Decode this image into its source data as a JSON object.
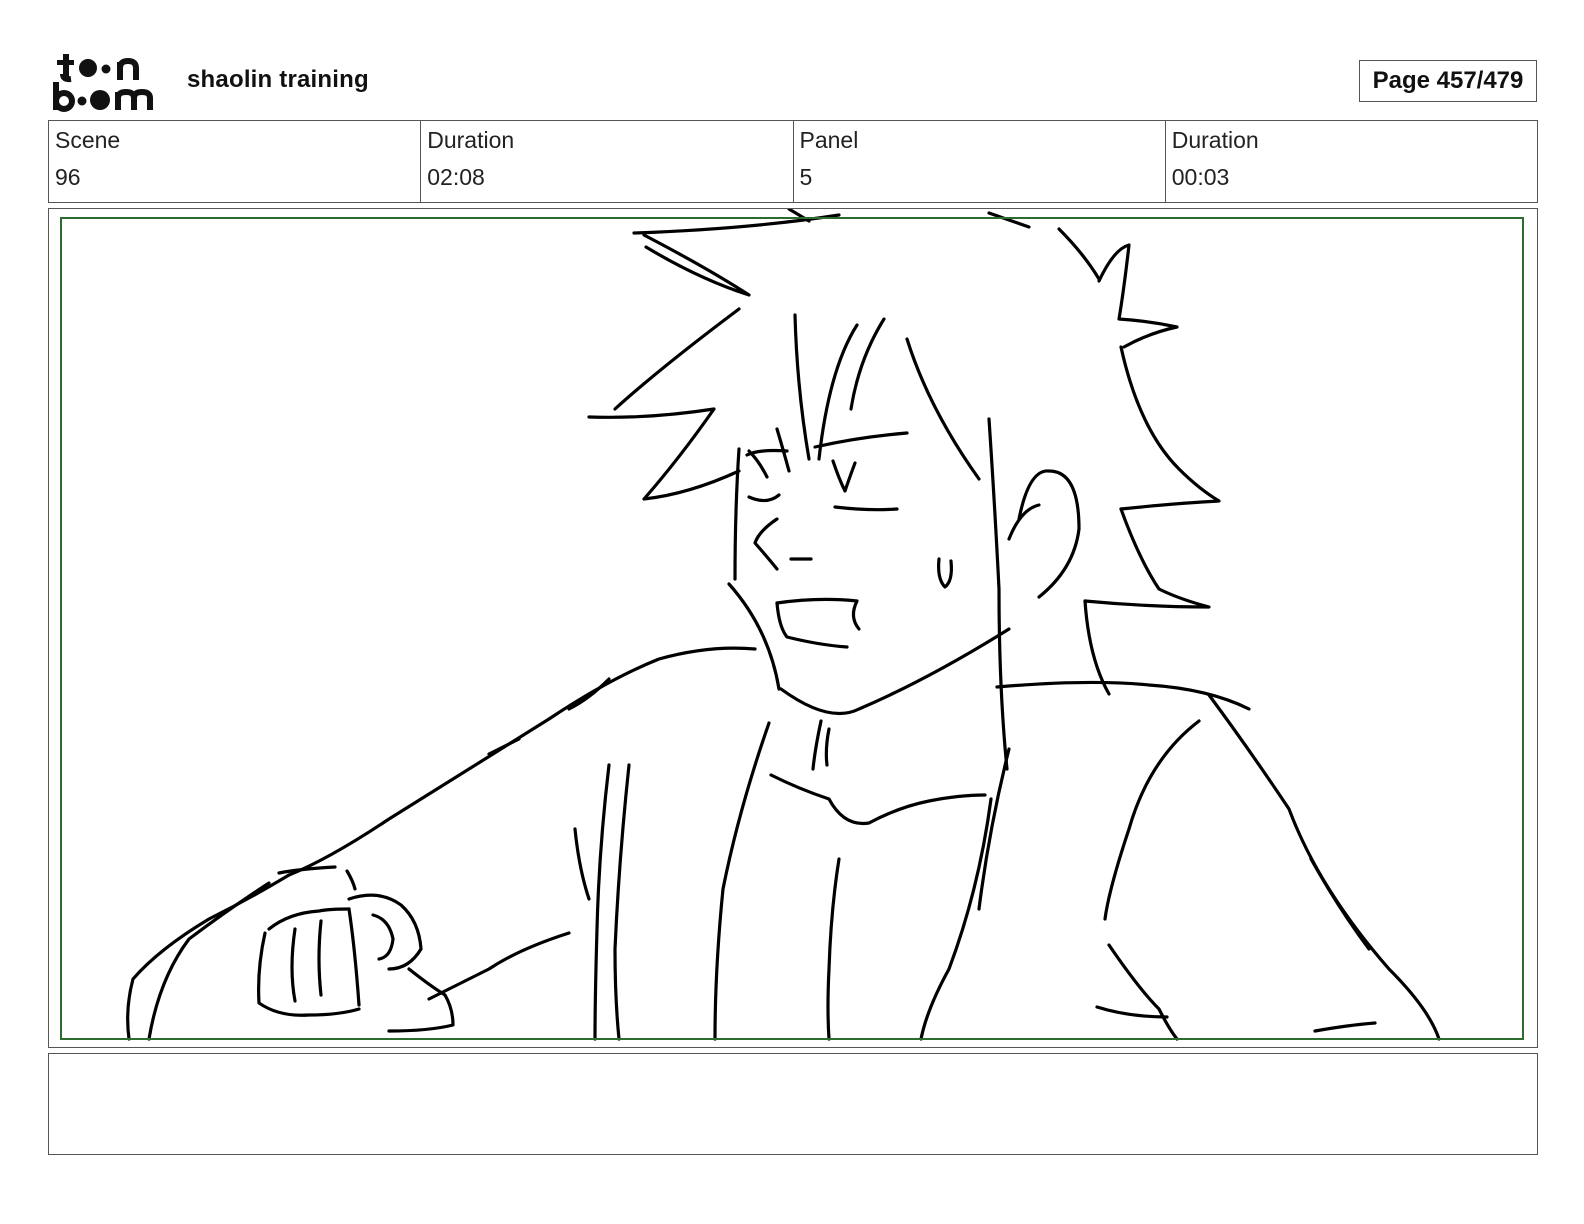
{
  "header": {
    "logo_text": "toon boom",
    "project_title": "shaolin training",
    "page_counter": "Page 457/479"
  },
  "info_table": [
    {
      "label": "Scene",
      "value": "96"
    },
    {
      "label": "Duration",
      "value": "02:08"
    },
    {
      "label": "Panel",
      "value": "5"
    },
    {
      "label": "Duration",
      "value": "00:03"
    }
  ],
  "panel": {
    "sketch_description_icon": "sketch-drawing",
    "safe_frame_color": "#2e6b2e"
  },
  "notes": {
    "text": ""
  }
}
